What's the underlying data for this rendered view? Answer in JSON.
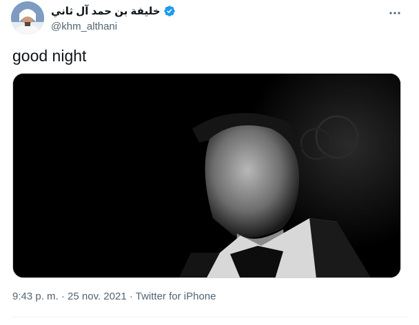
{
  "author": {
    "display_name": "خليفة بن حمد آل ثاني",
    "handle": "@khm_althani",
    "verified": true,
    "verified_color": "#1d9bf0"
  },
  "tweet": {
    "text": "good night"
  },
  "meta": {
    "time": "9:43 p. m.",
    "separator": " · ",
    "date": "25 nov. 2021",
    "source": "Twitter for iPhone"
  },
  "icons": {
    "verified": "verified-badge-icon",
    "more": "more-dots-icon"
  }
}
